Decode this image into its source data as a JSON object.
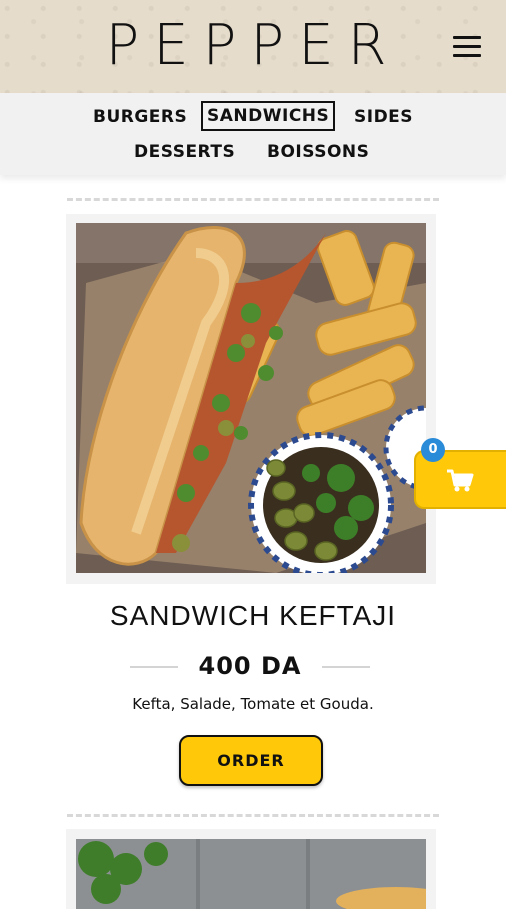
{
  "header": {
    "logo": "PEPPER",
    "menu_icon": "hamburger-menu-icon"
  },
  "nav": {
    "items": [
      {
        "label": "BURGERS",
        "active": false
      },
      {
        "label": "SANDWICHS",
        "active": true
      },
      {
        "label": "SIDES",
        "active": false
      },
      {
        "label": "DESSERTS",
        "active": false
      },
      {
        "label": "BOISSONS",
        "active": false
      }
    ]
  },
  "product": {
    "name": "SANDWICH KEFTAJI",
    "price": "400 DA",
    "description": "Kefta, Salade, Tomate et Gouda.",
    "order_label": "ORDER"
  },
  "cart": {
    "count": "0",
    "icon": "shopping-cart-icon"
  },
  "colors": {
    "accent": "#ffc90a",
    "badge": "#2a8bd8",
    "header_bg": "#e6dccb",
    "nav_bg": "#f1f1f1"
  }
}
